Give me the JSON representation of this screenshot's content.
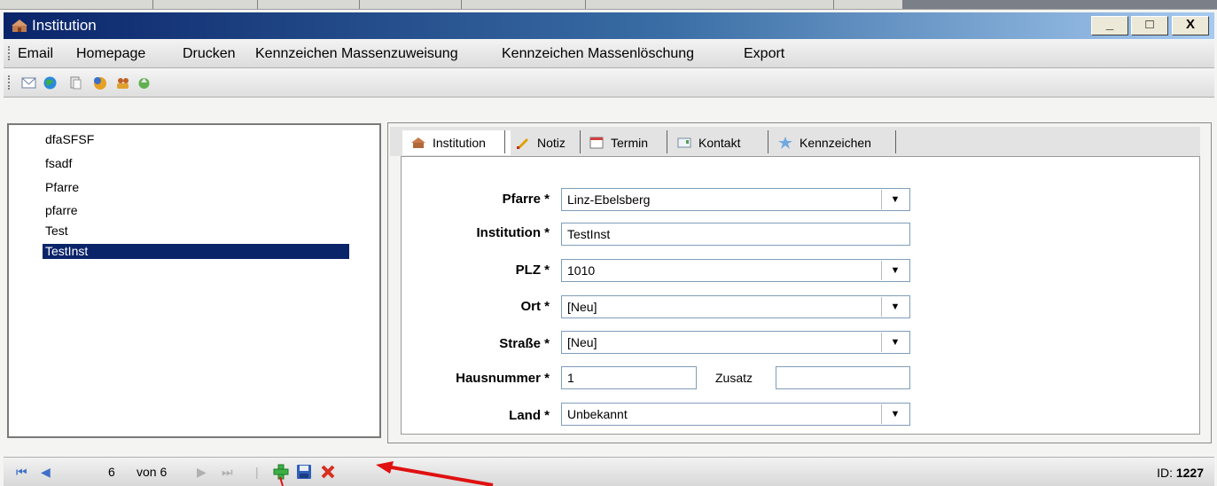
{
  "window": {
    "title": "Institution",
    "controls": [
      "_",
      "□",
      "X"
    ]
  },
  "menu": [
    "Email",
    "Homepage",
    "Drucken",
    "Kennzeichen Massenzuweisung",
    "Kennzeichen Massenlöschung",
    "Export"
  ],
  "toolbar_icons": [
    "mail-icon",
    "globe-icon",
    "print-icon",
    "tag-assign-icon",
    "tag-delete-icon",
    "export-icon"
  ],
  "list": {
    "items": [
      "dfaSFSF",
      "fsadf",
      "Pfarre",
      "pfarre",
      "Test",
      "TestInst"
    ],
    "selected_index": 5
  },
  "tabs": [
    {
      "label": "Institution",
      "icon": "institution-icon"
    },
    {
      "label": "Notiz",
      "icon": "note-icon"
    },
    {
      "label": "Termin",
      "icon": "calendar-icon"
    },
    {
      "label": "Kontakt",
      "icon": "contact-icon"
    },
    {
      "label": "Kennzeichen",
      "icon": "star-icon"
    }
  ],
  "form": {
    "pfarre": {
      "label": "Pfarre *",
      "value": "Linz-Ebelsberg"
    },
    "institution": {
      "label": "Institution *",
      "value": "TestInst"
    },
    "plz": {
      "label": "PLZ *",
      "value": "1010"
    },
    "ort": {
      "label": "Ort *",
      "value": "[Neu]"
    },
    "strasse": {
      "label": "Straße *",
      "value": "[Neu]"
    },
    "hausnummer": {
      "label": "Hausnummer *",
      "value": "1"
    },
    "zusatz": {
      "label": "Zusatz",
      "value": ""
    },
    "land": {
      "label": "Land *",
      "value": "Unbekannt"
    },
    "dropdown_glyph": "▼"
  },
  "status": {
    "current": "6",
    "of_text": "von 6",
    "id_label": "ID:",
    "id_value": "1227"
  },
  "colors": {
    "titlebar_start": "#0a246a",
    "selection": "#0a246a",
    "arrow": "#e01010"
  }
}
